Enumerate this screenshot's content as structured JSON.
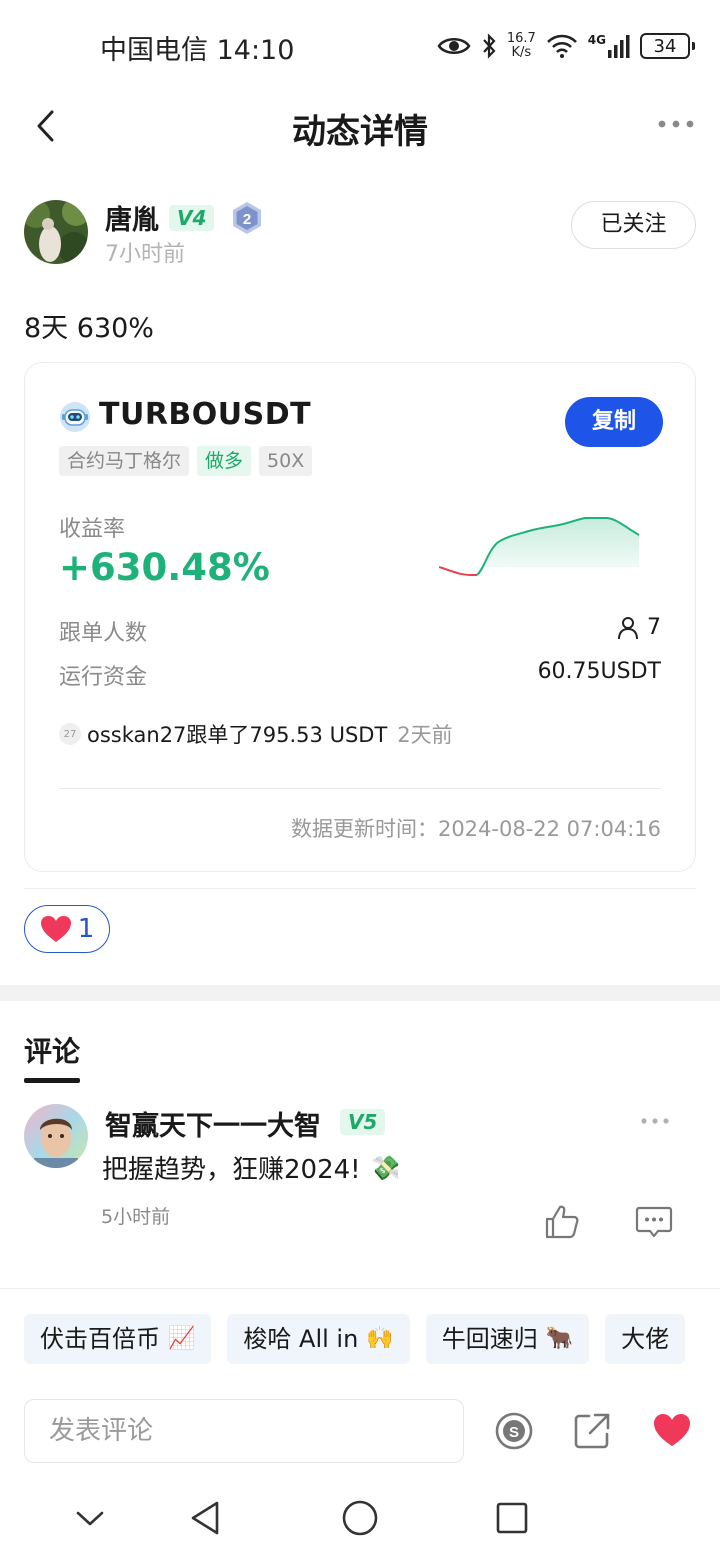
{
  "status_bar": {
    "carrier_time": "中国电信 14:10",
    "net_speed_value": "16.7",
    "net_speed_unit": "K/s",
    "network": "4G",
    "battery": "34"
  },
  "nav": {
    "title": "动态详情"
  },
  "author": {
    "name": "唐胤",
    "vip": "V4",
    "level": "2",
    "time": "7小时前",
    "follow_label": "已关注"
  },
  "post": {
    "text": "8天 630%"
  },
  "card": {
    "coin": "TURBOUSDT",
    "copy_label": "复制",
    "tags": [
      "合约马丁格尔",
      "做多",
      "50X"
    ],
    "yield_label": "收益率",
    "yield_value": "+630.48%",
    "followers_label": "跟单人数",
    "followers_value": "7",
    "funds_label": "运行资金",
    "funds_value": "60.75USDT",
    "follower_avatar_text": "27",
    "follower_event": "osskan27跟单了795.53 USDT",
    "follower_event_time": "2天前",
    "update_time": "数据更新时间：2024-08-22 07:04:16",
    "chart_color_up": "#1eb27a",
    "chart_color_down": "#e8414c"
  },
  "likes": {
    "count": "1"
  },
  "comments": {
    "tab_label": "评论",
    "items": [
      {
        "name": "智赢天下一一大智",
        "vip": "V5",
        "text": "把握趋势，狂赚2024!",
        "emoji": "💸",
        "time": "5小时前"
      }
    ]
  },
  "quick_replies": [
    {
      "label": "伏击百倍币",
      "emoji": "📈"
    },
    {
      "label": "梭哈 All in",
      "emoji": "🙌"
    },
    {
      "label": "牛回速归",
      "emoji": "🐂"
    },
    {
      "label": "大佬",
      "emoji": ""
    }
  ],
  "composer": {
    "placeholder": "发表评论"
  },
  "colors": {
    "accent": "#1e55e8",
    "positive": "#1eb27a",
    "like": "#f0385a",
    "link_border": "#2855c7"
  }
}
